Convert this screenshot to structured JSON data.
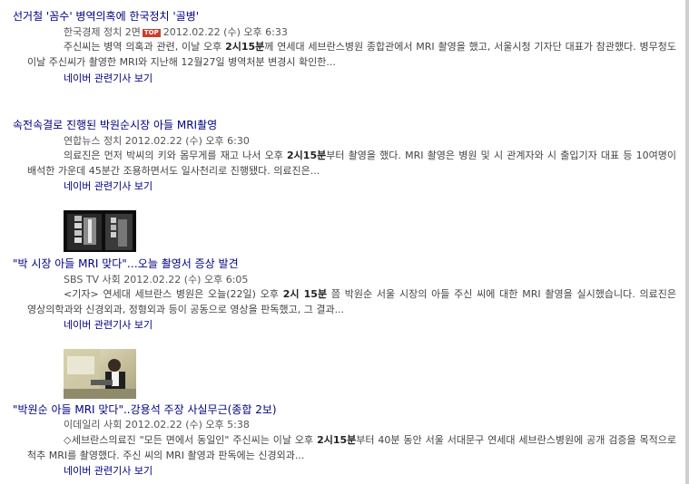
{
  "articles": [
    {
      "title": "선거철 '꼼수' 병역의혹에 한국정치 '골병'",
      "source": "한국경제 정치 2면",
      "badge": "TOP",
      "date": "2012.02.22 (수) 오후 6:33",
      "snippet_pre": "주신씨는 병역 의혹과 관련, 이날 오후 ",
      "snippet_bold": "2시15분",
      "snippet_post": "께 연세대 세브란스병원 종합관에서 MRI 촬영을 했고, 서울시청 기자단 대표가 참관했다. 병무청도 이날 주신씨가 촬영한 MRI와 지난해 12월27일 병역처분 변경시 확인한...",
      "related_label": "네이버 관련기사 보기"
    },
    {
      "title": "속전속결로 진행된 박원순시장 아들 MRI촬영",
      "source": "연합뉴스 정치",
      "date": "2012.02.22 (수) 오후 6:30",
      "snippet_pre": "의료진은 먼저 박씨의 키와 몸무게를 재고 나서 오후 ",
      "snippet_bold": "2시15분",
      "snippet_post": "부터 촬영을 했다. MRI 촬영은 병원 및 시 관계자와 시 출입기자 대표 등 10여명이 배석한 가운데 45분간 조용하면서도 일사천리로 진행됐다. 의료진은...",
      "related_label": "네이버 관련기사 보기"
    },
    {
      "title": "\"박 시장 아들 MRI 맞다\"…오늘 촬영서 증상 발견",
      "source": "SBS TV 사회",
      "date": "2012.02.22 (수) 오후 6:05",
      "snippet_pre": "<기자> 연세대 세브란스 병원은 오늘(22일) 오후 ",
      "snippet_bold": "2시 15분",
      "snippet_post": " 쯤 박원순 서울 시장의 아들 주신 씨에 대한 MRI 촬영을 실시했습니다. 의료진은 영상의학과와 신경외과, 정형외과 등이 공동으로 영상을 판독했고, 그 결과...",
      "related_label": "네이버 관련기사 보기"
    },
    {
      "title": "\"박원순 아들 MRI 맞다\"..강용석 주장 사실무근(종합 2보)",
      "source": "이데일리 사회",
      "date": "2012.02.22 (수) 오후 5:38",
      "snippet_pre": "◇세브란스의료진 \"모든 면에서 동일인\" 주신씨는 이날 오후 ",
      "snippet_bold": "2시15분",
      "snippet_post": "부터 40분 동안 서울 서대문구 연세대 세브란스병원에 공개 검증을 목적으로 척추 MRI를 촬영했다. 주신 씨의 MRI 촬영과 판독에는 신경외과...",
      "related_label": "네이버 관련기사 보기"
    }
  ],
  "colors": {
    "title": "#000080",
    "meta": "#555555",
    "snippet": "#444444",
    "badge_bg": "#d03b2b"
  }
}
